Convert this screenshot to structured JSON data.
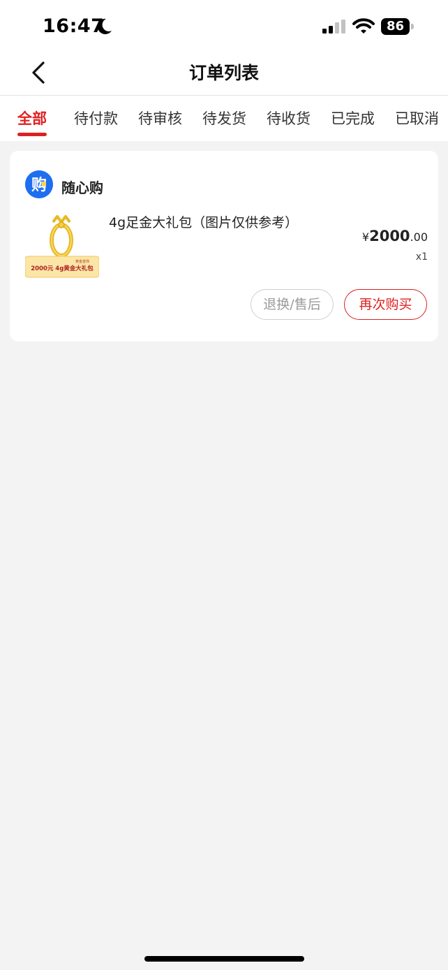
{
  "status_bar": {
    "time": "16:47",
    "battery": "86",
    "icons": [
      "moon-icon",
      "signal-icon",
      "wifi-icon",
      "battery-icon"
    ]
  },
  "nav": {
    "title": "订单列表",
    "back_icon": "chevron-left-icon"
  },
  "tabs": [
    {
      "label": "全部",
      "active": true
    },
    {
      "label": "待付款",
      "active": false
    },
    {
      "label": "待审核",
      "active": false
    },
    {
      "label": "待发货",
      "active": false
    },
    {
      "label": "待收货",
      "active": false
    },
    {
      "label": "已完成",
      "active": false
    },
    {
      "label": "已取消",
      "active": false
    }
  ],
  "order": {
    "shop": {
      "name": "随心购",
      "logo_glyph": "购"
    },
    "product": {
      "name": "4g足金大礼包（图片仅供参考）",
      "thumb_tag": "黄金首饰",
      "thumb_banner": "2000元   4g黄金大礼包"
    },
    "price": {
      "currency": "¥",
      "integer": "2000",
      "decimal": ".00"
    },
    "quantity": "x1",
    "buttons": {
      "after_sale": "退换/售后",
      "rebuy": "再次购买"
    }
  },
  "colors": {
    "accent": "#e02020",
    "page_bg": "#f3f3f3",
    "logo_blue": "#1e6ff0",
    "gold": "#e8b923"
  }
}
